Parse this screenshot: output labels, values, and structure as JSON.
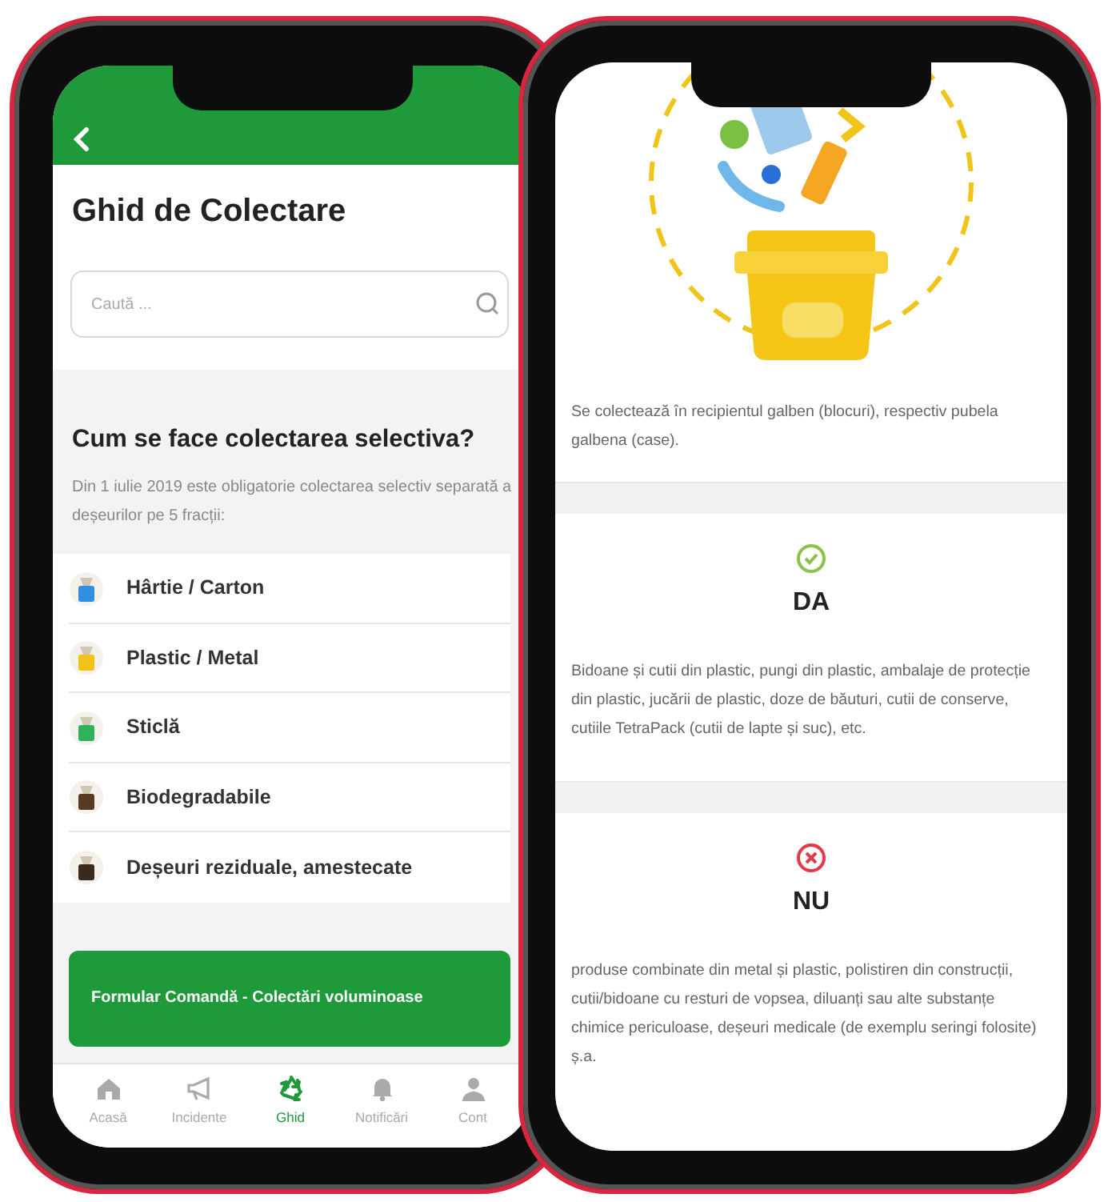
{
  "left_screen": {
    "title": "Ghid de Colectare",
    "search": {
      "placeholder": "Caută ..."
    },
    "section": {
      "heading": "Cum se face colectarea selectiva?",
      "description": "Din 1 iulie 2019 este obligatorie colectarea selectiv separată a deșeurilor pe 5 fracții:"
    },
    "categories": [
      {
        "label": "Hârtie / Carton",
        "color": "#2f8fe0"
      },
      {
        "label": "Plastic / Metal",
        "color": "#f2c318"
      },
      {
        "label": "Sticlă",
        "color": "#2fb35a"
      },
      {
        "label": "Biodegradabile",
        "color": "#5a3b22"
      },
      {
        "label": "Deșeuri reziduale, amestecate",
        "color": "#3a2a1c"
      }
    ],
    "order_button": "Formular Comandă - Colectări voluminoase",
    "tab_bar": [
      {
        "label": "Acasă",
        "kind": "home",
        "selected": false
      },
      {
        "label": "Incidente",
        "kind": "megaphone",
        "selected": false
      },
      {
        "label": "Ghid",
        "kind": "recycle",
        "selected": true
      },
      {
        "label": "Notificări",
        "kind": "bell",
        "selected": false
      },
      {
        "label": "Cont",
        "kind": "person",
        "selected": false
      }
    ]
  },
  "right_screen": {
    "intro": "Se colectează în recipientul galben (blocuri), respectiv pubela galbena (case).",
    "sections": [
      {
        "kind": "yes",
        "title": "DA",
        "text": "Bidoane și cutii din plastic, pungi din plastic, ambalaje de protecție din plastic, jucării de plastic, doze de băuturi, cutii de conserve, cutiile TetraPack (cutii de lapte și suc), etc."
      },
      {
        "kind": "no",
        "title": "NU",
        "text": "produse combinate din metal și plastic, polistiren din construcții, cutii/bidoane cu resturi de vopsea, diluanți sau alte substanțe chimice periculoase, deșeuri medicale (de exemplu seringi folosite) ș.a."
      }
    ]
  }
}
